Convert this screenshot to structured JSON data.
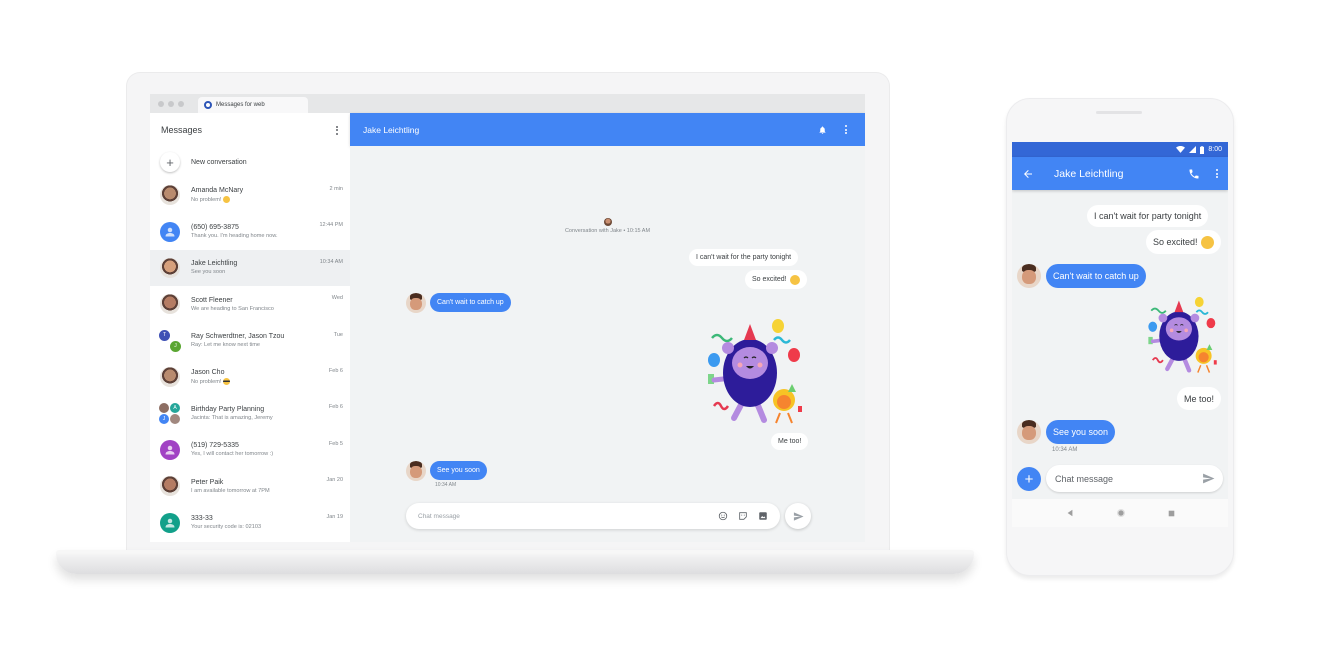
{
  "laptop": {
    "browser": {
      "tab_title": "Messages for web"
    },
    "sidebar": {
      "title": "Messages",
      "new_conversation_label": "New conversation",
      "conversations": [
        {
          "name": "Amanda McNary",
          "snippet": "No problem!",
          "time": "2 min",
          "avatar": "photo",
          "emoji": "smile-emoji"
        },
        {
          "name": "(650) 695-3875",
          "snippet": "Thank you. I'm heading home now.",
          "time": "12:44 PM",
          "avatar": "person-blue"
        },
        {
          "name": "Jake Leichtling",
          "snippet": "See you soon",
          "time": "10:34 AM",
          "avatar": "photo",
          "active": true
        },
        {
          "name": "Scott Fleener",
          "snippet": "We are heading to San Francisco",
          "time": "Wed",
          "avatar": "photo"
        },
        {
          "name": "Ray Schwerdtner, Jason Tzou",
          "snippet": "Ray: Let me know next time",
          "time": "Tue",
          "avatar": "group",
          "initials": [
            "T",
            "J"
          ]
        },
        {
          "name": "Jason Cho",
          "snippet": "No problem!",
          "time": "Feb 6",
          "avatar": "photo",
          "emoji": "sunglasses-emoji"
        },
        {
          "name": "Birthday Party Planning",
          "snippet": "Jacinta: That is amazing, Jeremy",
          "time": "Feb 6",
          "avatar": "group4",
          "initials": [
            "A",
            "J"
          ]
        },
        {
          "name": "(519) 729-5335",
          "snippet": "Yes, I will contact her tomorrow :)",
          "time": "Feb 5",
          "avatar": "person-purple"
        },
        {
          "name": "Peter Paik",
          "snippet": "I am available tomorrow at 7PM",
          "time": "Jan 20",
          "avatar": "photo"
        },
        {
          "name": "333-33",
          "snippet": "Your security code is: 02103",
          "time": "Jan 19",
          "avatar": "person-teal"
        }
      ]
    },
    "conversation": {
      "title": "Jake Leichtling",
      "start_text": "Conversation with Jake • 10:15 AM",
      "messages": [
        {
          "direction": "out",
          "text": "I can't wait for the party tonight"
        },
        {
          "direction": "out",
          "text": "So excited!",
          "emoji": "yum-emoji"
        },
        {
          "direction": "in",
          "text": "Can't wait to catch up"
        },
        {
          "direction": "out",
          "sticker": "party-monster-sticker"
        },
        {
          "direction": "out",
          "text": "Me too!"
        },
        {
          "direction": "in",
          "text": "See you soon",
          "time": "10:34 AM"
        }
      ],
      "compose_placeholder": "Chat message"
    }
  },
  "phone": {
    "status_time": "8:00",
    "title": "Jake Leichtling",
    "messages": [
      {
        "direction": "out",
        "text": "I can't wait for party tonight"
      },
      {
        "direction": "out",
        "text": "So excited!",
        "emoji": "yum-emoji"
      },
      {
        "direction": "in",
        "text": "Can't wait to catch up"
      },
      {
        "direction": "out",
        "sticker": "party-monster-sticker"
      },
      {
        "direction": "out",
        "text": "Me too!"
      },
      {
        "direction": "in",
        "text": "See you soon",
        "time": "10:34 AM"
      }
    ],
    "compose_placeholder": "Chat message"
  },
  "colors": {
    "accent": "#4285f4",
    "status_bar": "#3367d6",
    "background": "#f1f3f4"
  }
}
